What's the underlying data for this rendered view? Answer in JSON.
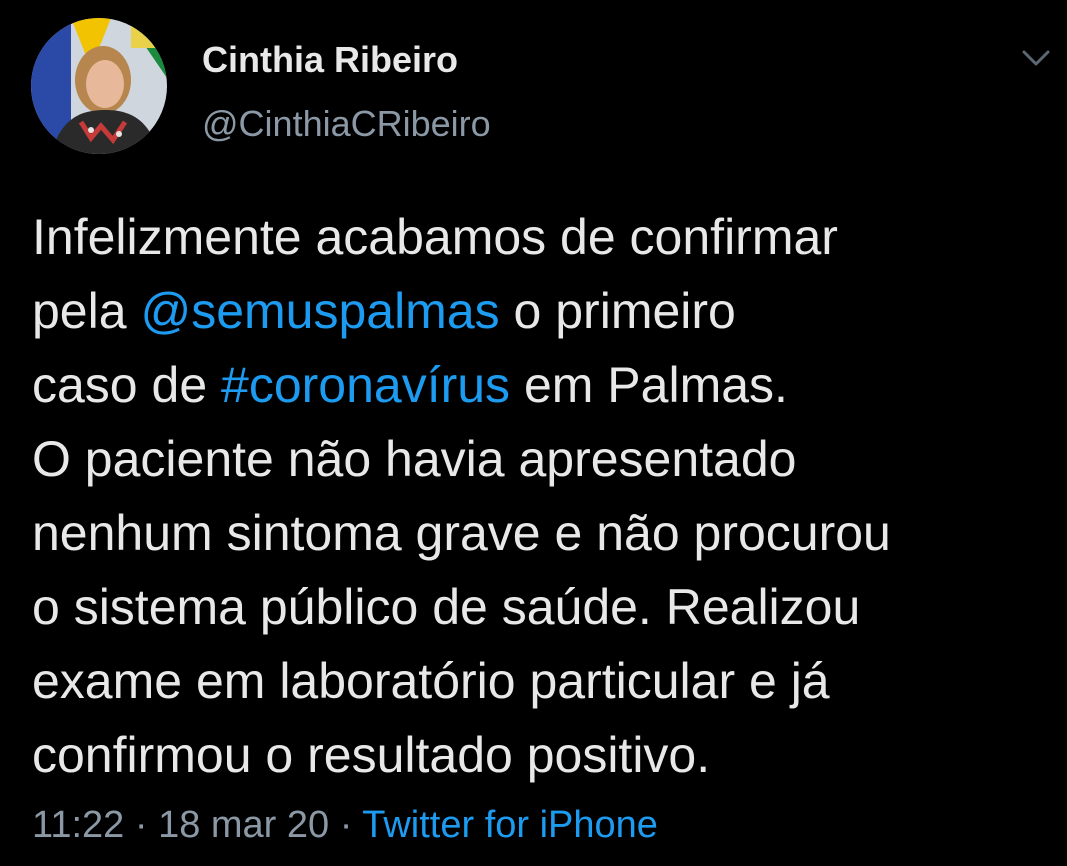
{
  "author": {
    "display_name": "Cinthia Ribeiro",
    "handle": "@CinthiaCRibeiro",
    "avatar_icon": "profile-photo"
  },
  "menu": {
    "icon": "chevron-down-icon"
  },
  "tweet": {
    "lines": [
      {
        "text": "Infelizmente acabamos de confirmar"
      },
      {
        "pre": "pela ",
        "link": "@semuspalmas",
        "post": " o primeiro"
      },
      {
        "pre": "caso de ",
        "link": "#coronavírus",
        "post": " em Palmas."
      },
      {
        "text": "O paciente não havia apresentado"
      },
      {
        "text": "nenhum sintoma grave e não procurou"
      },
      {
        "text": "o sistema público de saúde. Realizou"
      },
      {
        "text": "exame em laboratório particular e já"
      },
      {
        "text": "confirmou o resultado positivo."
      }
    ]
  },
  "meta": {
    "time": "11:22",
    "separator": "·",
    "date": "18 mar 20",
    "source": "Twitter for iPhone"
  },
  "colors": {
    "background": "#000000",
    "text": "#e8e8e8",
    "secondary": "#8b98a5",
    "link": "#1d9bf0"
  }
}
